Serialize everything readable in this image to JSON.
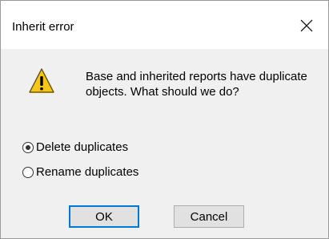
{
  "dialog": {
    "title": "Inherit error",
    "message": "Base and inherited reports have duplicate objects. What should we do?",
    "icon": "warning-icon"
  },
  "options": [
    {
      "label": "Delete duplicates",
      "checked": true
    },
    {
      "label": "Rename duplicates",
      "checked": false
    }
  ],
  "buttons": {
    "ok_label": "OK",
    "cancel_label": "Cancel"
  },
  "colors": {
    "accent": "#0078d7",
    "warning": "#f5c518"
  }
}
